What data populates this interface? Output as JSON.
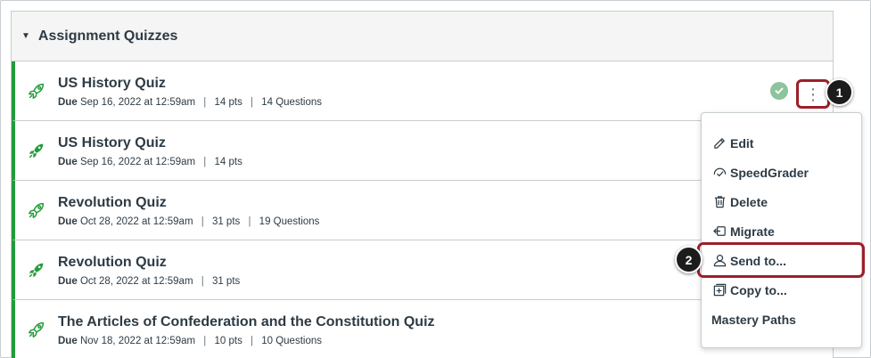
{
  "group": {
    "title": "Assignment Quizzes",
    "caret_icon": "caret-down-icon"
  },
  "quizzes": [
    {
      "title": "US History Quiz",
      "due_label": "Due",
      "due_date": "Sep 16, 2022 at 12:59am",
      "points": "14 pts",
      "questions": "14 Questions",
      "published": false
    },
    {
      "title": "US History Quiz",
      "due_label": "Due",
      "due_date": "Sep 16, 2022 at 12:59am",
      "points": "14 pts",
      "questions": "",
      "published": true
    },
    {
      "title": "Revolution Quiz",
      "due_label": "Due",
      "due_date": "Oct 28, 2022 at 12:59am",
      "points": "31 pts",
      "questions": "19 Questions",
      "published": false
    },
    {
      "title": "Revolution Quiz",
      "due_label": "Due",
      "due_date": "Oct 28, 2022 at 12:59am",
      "points": "31 pts",
      "questions": "",
      "published": true
    },
    {
      "title": "The Articles of Confederation and the Constitution Quiz",
      "due_label": "Due",
      "due_date": "Nov 18, 2022 at 12:59am",
      "points": "10 pts",
      "questions": "10 Questions",
      "published": false
    }
  ],
  "menu": {
    "items": [
      {
        "label": "Edit",
        "icon": "pencil-icon"
      },
      {
        "label": "SpeedGrader",
        "icon": "speedgrader-icon"
      },
      {
        "label": "Delete",
        "icon": "trash-icon"
      },
      {
        "label": "Migrate",
        "icon": "migrate-icon"
      },
      {
        "label": "Send to...",
        "icon": "user-icon"
      },
      {
        "label": "Copy to...",
        "icon": "copy-icon"
      },
      {
        "label": "Mastery Paths",
        "icon": ""
      }
    ]
  },
  "callouts": [
    "1",
    "2"
  ],
  "colors": {
    "accent_green": "#239b3a",
    "highlight_red": "#9b1f2a",
    "published_green": "#8dc49d"
  }
}
